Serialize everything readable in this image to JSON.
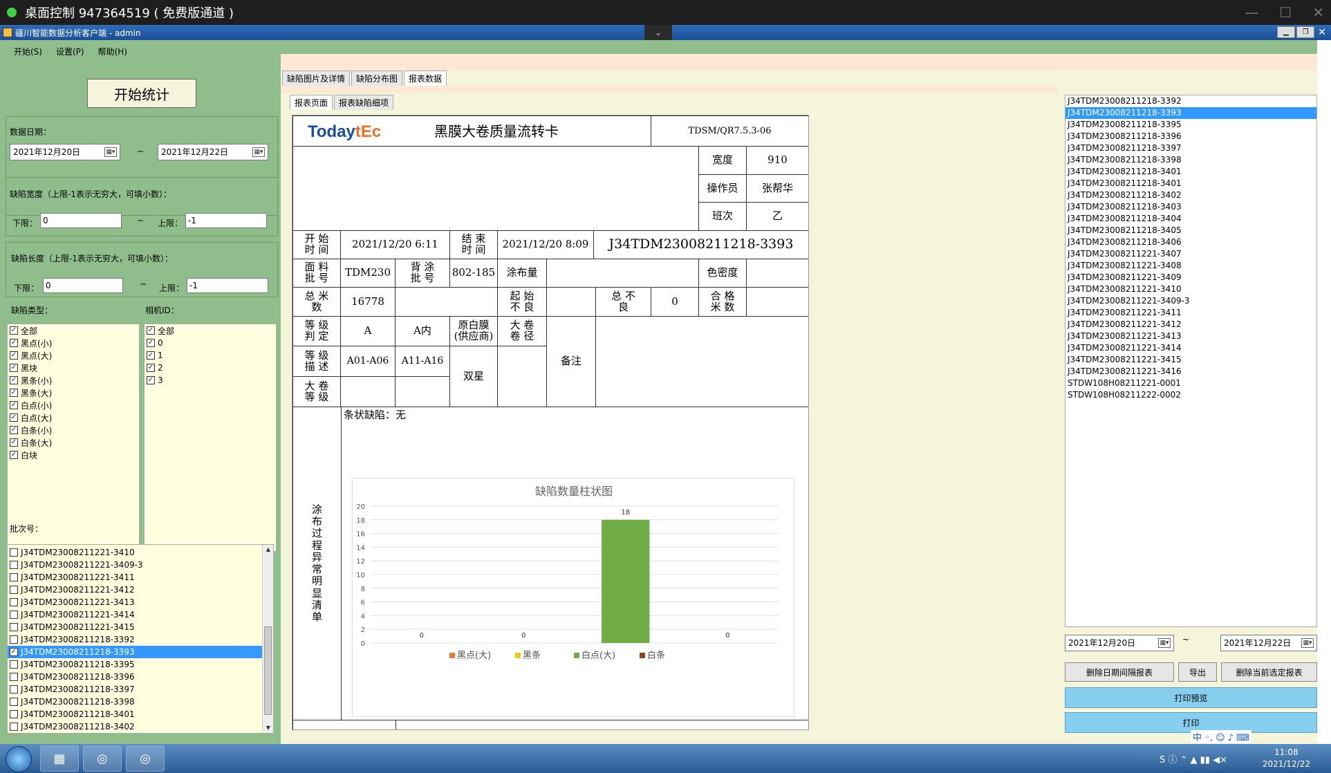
{
  "remote_bar": {
    "title": "桌面控制 947364519 ( 免费版通道 )",
    "min": "—",
    "max": "☐",
    "close": "✕"
  },
  "app_bar": {
    "title": "疆川智能数据分析客户端 - admin",
    "drop": "⌄",
    "min": "▁",
    "restore": "❐",
    "close": "✕"
  },
  "menu": [
    "开始(S)",
    "设置(P)",
    "帮助(H)"
  ],
  "left": {
    "start_button": "开始统计",
    "date_label": "数据日期：",
    "date_from": "2021年12月20日",
    "date_to": "2021年12月22日",
    "tilde": "~",
    "cal_glyph": "▦▾",
    "width_label": "缺陷宽度（上限-1表示无穷大，可填小数）：",
    "width_lower_label": "下限：",
    "width_lower": "0",
    "width_upper_label": "上限：",
    "width_upper": "-1",
    "length_label": "缺陷长度（上限-1表示无穷大，可填小数）：",
    "length_lower_label": "下限：",
    "length_lower": "0",
    "length_upper_label": "上限：",
    "length_upper": "-1",
    "type_label": "缺陷类型：",
    "camera_label": "相机ID：",
    "defect_types": [
      "全部",
      "黑点(小)",
      "黑点(大)",
      "黑块",
      "黑条(小)",
      "黑条(大)",
      "白点(小)",
      "白点(大)",
      "白条(小)",
      "白条(大)",
      "白块"
    ],
    "camera_ids": [
      "全部",
      "0",
      "1",
      "2",
      "3"
    ],
    "batch_label": "批次号：",
    "batches": [
      {
        "name": "J34TDM23008211221-3410",
        "checked": false,
        "selected": false
      },
      {
        "name": "J34TDM23008211221-3409-3",
        "checked": false,
        "selected": false
      },
      {
        "name": "J34TDM23008211221-3411",
        "checked": false,
        "selected": false
      },
      {
        "name": "J34TDM23008211221-3412",
        "checked": false,
        "selected": false
      },
      {
        "name": "J34TDM23008211221-3413",
        "checked": false,
        "selected": false
      },
      {
        "name": "J34TDM23008211221-3414",
        "checked": false,
        "selected": false
      },
      {
        "name": "J34TDM23008211221-3415",
        "checked": false,
        "selected": false
      },
      {
        "name": "J34TDM23008211218-3392",
        "checked": false,
        "selected": false
      },
      {
        "name": "J34TDM23008211218-3393",
        "checked": true,
        "selected": true
      },
      {
        "name": "J34TDM23008211218-3395",
        "checked": false,
        "selected": false
      },
      {
        "name": "J34TDM23008211218-3396",
        "checked": false,
        "selected": false
      },
      {
        "name": "J34TDM23008211218-3397",
        "checked": false,
        "selected": false
      },
      {
        "name": "J34TDM23008211218-3398",
        "checked": false,
        "selected": false
      },
      {
        "name": "J34TDM23008211218-3401",
        "checked": false,
        "selected": false
      },
      {
        "name": "J34TDM23008211218-3402",
        "checked": false,
        "selected": false
      }
    ],
    "scroll_up": "▲",
    "scroll_down": "▼"
  },
  "tabs": {
    "outer": [
      "缺陷图片及详情",
      "缺陷分布图",
      "报表数据"
    ],
    "inner": [
      "报表页面",
      "报表缺陷细项"
    ]
  },
  "report": {
    "logo_a": "Today",
    "logo_b": "tEc",
    "title": "黑膜大卷质量流转卡",
    "code": "TDSM/QR7.5.3-06",
    "width_label": "宽度",
    "width_value": "910",
    "operator_label": "操作员",
    "operator_value": "张帮华",
    "shift_label": "班次",
    "shift_value": "乙",
    "start_time_label": "开 始 时 间",
    "start_time": "2021/12/20 6:11",
    "end_time_label": "结 束 时 间",
    "end_time": "2021/12/20 8:09",
    "batch_no": "J34TDM23008211218-3393",
    "face_batch_label": "面 料 批 号",
    "face_batch": "TDM230",
    "back_batch_label": "背 涂 批 号",
    "back_batch": "802-185",
    "coating_label": "涂布量",
    "color_label": "色密度",
    "total_m_label": "总 米 数",
    "total_m": "16778",
    "start_bad_label": "起 始 不 良",
    "total_bad_label": "总 不 良",
    "total_bad": "0",
    "ok_m_label": "合 格 米 数",
    "grade_label": "等 级 判 定",
    "grade": "A",
    "grade2": "A内",
    "raw_film_label": "原白膜 (供应商)",
    "roll_dia_label": "大 卷 卷 径",
    "remark_label": "备注",
    "grade_desc_label": "等 级 描 述",
    "grade_desc1": "A01-A06",
    "grade_desc2": "A11-A16",
    "supplier": "双星",
    "roll_grade_label": "大 卷 等 级",
    "process_label": "涂布过程异常明显清单",
    "stripe_defect": "条状缺陷：无"
  },
  "chart_data": {
    "type": "bar",
    "title": "缺陷数量柱状图",
    "categories": [
      "黑点(大)",
      "黑条",
      "白点(大)",
      "白条"
    ],
    "values": [
      0,
      0,
      18,
      0
    ],
    "colors": [
      "#e07b39",
      "#f5c518",
      "#70ad47",
      "#8b4513"
    ],
    "ylim": [
      0,
      20
    ],
    "yticks": [
      0,
      2,
      4,
      6,
      8,
      10,
      12,
      14,
      16,
      18,
      20
    ],
    "legend": "bottom",
    "grid": true
  },
  "right": {
    "items": [
      "J34TDM23008211218-3392",
      "J34TDM23008211218-3393",
      "J34TDM23008211218-3395",
      "J34TDM23008211218-3396",
      "J34TDM23008211218-3397",
      "J34TDM23008211218-3398",
      "J34TDM23008211218-3401",
      "J34TDM23008211218-3401",
      "J34TDM23008211218-3402",
      "J34TDM23008211218-3403",
      "J34TDM23008211218-3404",
      "J34TDM23008211218-3405",
      "J34TDM23008211218-3406",
      "J34TDM23008211221-3407",
      "J34TDM23008211221-3408",
      "J34TDM23008211221-3409",
      "J34TDM23008211221-3410",
      "J34TDM23008211221-3409-3",
      "J34TDM23008211221-3411",
      "J34TDM23008211221-3412",
      "J34TDM23008211221-3413",
      "J34TDM23008211221-3414",
      "J34TDM23008211221-3415",
      "J34TDM23008211221-3416",
      "STDW108H08211221-0001",
      "STDW108H08211222-0002"
    ],
    "selected_index": 1,
    "date_from": "2021年12月20日",
    "date_to": "2021年12月22日",
    "tilde": "~",
    "delete_range": "删除日期间隔报表",
    "export": "导出",
    "delete_selected": "删除当前选定报表",
    "print_preview": "打印预览",
    "print": "打印"
  },
  "taskbar": {
    "time": "11:08",
    "date": "2021/12/22",
    "tray": "S ⓘ ⌃ ▲ ▮▮ ◀×",
    "ime": "中 ◦, ☺ ♪ ⌨"
  }
}
